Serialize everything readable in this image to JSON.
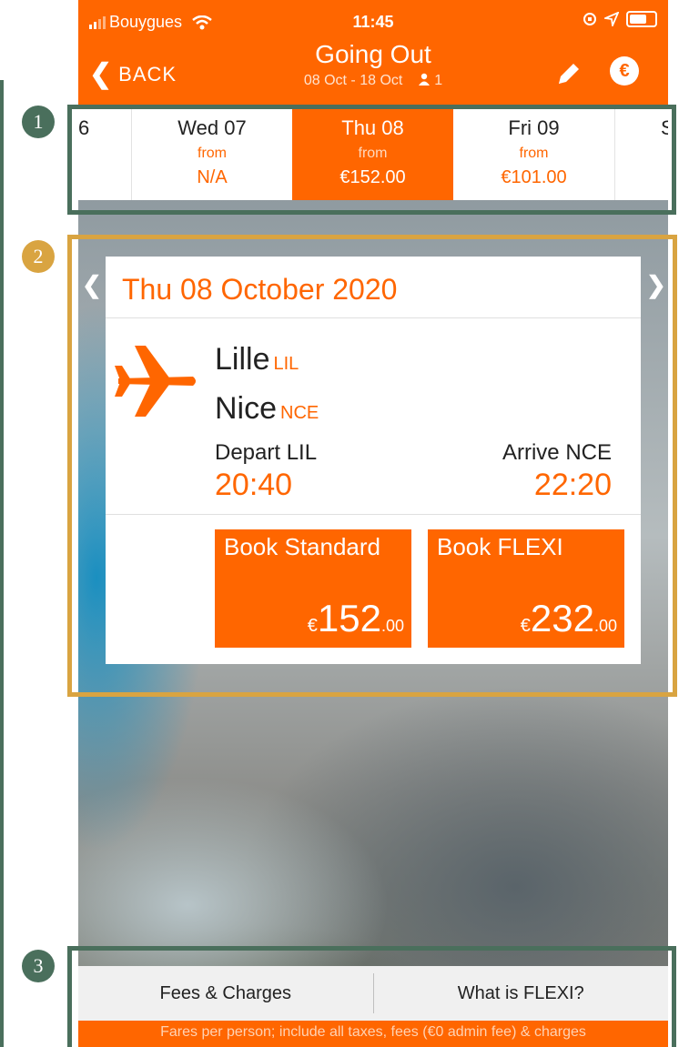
{
  "status_bar": {
    "carrier": "Bouygues",
    "time": "11:45"
  },
  "nav": {
    "back_label": "BACK",
    "title": "Going Out",
    "subtitle": "08 Oct - 18 Oct",
    "passengers": "1"
  },
  "dates": [
    {
      "day": "6",
      "from": "",
      "price": ""
    },
    {
      "day": "Wed 07",
      "from": "from",
      "price": "N/A"
    },
    {
      "day": "Thu 08",
      "from": "from",
      "price": "€152.00"
    },
    {
      "day": "Fri 09",
      "from": "from",
      "price": "€101.00"
    },
    {
      "day": "S",
      "from": "",
      "price": ""
    }
  ],
  "flight": {
    "date": "Thu 08 October 2020",
    "origin_city": "Lille",
    "origin_code": "LIL",
    "dest_city": "Nice",
    "dest_code": "NCE",
    "depart_label": "Depart LIL",
    "depart_time": "20:40",
    "arrive_label": "Arrive NCE",
    "arrive_time": "22:20"
  },
  "book_standard": {
    "label": "Book Standard",
    "currency": "€",
    "price_int": "152",
    "price_dec": ".00"
  },
  "book_flexi": {
    "label": "Book FLEXI",
    "currency": "€",
    "price_int": "232",
    "price_dec": ".00"
  },
  "bottom": {
    "fees_label": "Fees & Charges",
    "flexi_label": "What is FLEXI?",
    "footer": "Fares per person; include all taxes, fees (€0 admin fee) & charges"
  },
  "annotations": {
    "one": "1",
    "two": "2",
    "three": "3"
  },
  "colors": {
    "brand": "#ff6600",
    "highlight_green": "#4a6f5c",
    "highlight_gold": "#d9a441"
  }
}
